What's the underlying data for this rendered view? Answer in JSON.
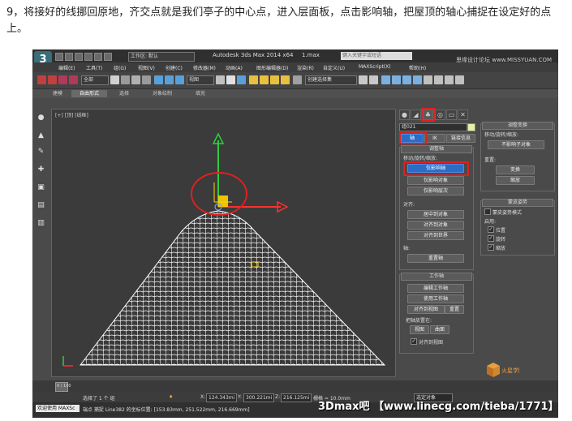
{
  "caption": "9，将接好的线挪回原地，齐交点就是我们亭子的中心点，进入层面板，点击影响轴，把屋顶的轴心捕捉在设定好的点上。",
  "app": {
    "logo": "3",
    "workspace": "工作区: 默认",
    "title": "Autodesk 3ds Max  2014 x64",
    "file": "1.max",
    "search_placeholder": "键入关键字或短语"
  },
  "menu": [
    "编辑(E)",
    "工具(T)",
    "组(G)",
    "视图(V)",
    "创建(C)",
    "修改器(M)",
    "动画(A)",
    "图形编辑器(D)",
    "渲染(R)",
    "自定义(U)",
    "MAXScript(X)",
    "帮助(H)"
  ],
  "toolbar": {
    "mode_dropdown": "全部",
    "view_dropdown": "视图",
    "selection_set": "创建选择集"
  },
  "ribbon": {
    "tabs": [
      "建模",
      "自由形式",
      "选择",
      "对象绘制",
      "填充"
    ],
    "active": "自由形式"
  },
  "viewport": {
    "label": "[+] [顶] [线框]"
  },
  "command_panel": {
    "object_name": "组021",
    "tabs": [
      "轴",
      "IK",
      "链接信息"
    ],
    "adjust_pivot": {
      "title": "调整轴",
      "move_label": "移动/旋转/缩放:",
      "buttons": [
        "仅影响轴",
        "仅影响对象",
        "仅影响层次"
      ],
      "active_button": "仅影响轴",
      "align_label": "对齐:",
      "align_buttons": [
        "居中到对象",
        "对齐到对象",
        "对齐到世界"
      ],
      "pivot_label": "轴:",
      "reset_button": "重置轴"
    },
    "working_pivot": {
      "title": "工作轴",
      "buttons": [
        "编辑工作轴",
        "使用工作轴",
        "对齐到视图",
        "重置"
      ],
      "placement_label": "把轴放置在:",
      "placement_buttons": [
        "视图",
        "曲面"
      ],
      "align_to_view": "对齐到视图"
    }
  },
  "right_panel": {
    "adjust_transform": {
      "title": "调整变换",
      "move_label": "移动/旋转/缩放:",
      "dont_affect_children": "不影响子对象",
      "reset_label": "重置:",
      "reset_buttons": [
        "变换",
        "缩放"
      ]
    },
    "skin_pose": {
      "title": "蒙皮姿势",
      "enable_label": "启用:",
      "checkbox_mode": "蒙皮姿势模式",
      "checkboxes": [
        "位置",
        "旋转",
        "缩放"
      ]
    }
  },
  "status": {
    "frame_text": "0 / 100",
    "selected_text": "选择了 1 个 组",
    "x_label": "X:",
    "x_value": "124.343mi",
    "y_label": "Y:",
    "y_value": "300.221mi",
    "z_label": "Z:",
    "z_value": "216.125mi",
    "grid_label": "栅格 = 10.0mm",
    "welcome": "欢迎使用 MAXSc",
    "prompt": "端点 捕捉 Line382 的坐标位置: [153.83mm, 251.522mm, 216.669mm]",
    "select_dd": "选定对象"
  },
  "watermark": {
    "main": "3Dmax吧 【www.linecg.com/tieba/1771】",
    "site": "思缘设计论坛 www.MISSYUAN.COM",
    "brand": "火星学院"
  },
  "colors": {
    "highlight_red": "#e02020",
    "active_blue": "#2b6cc4",
    "gizmo_green": "#2ecc40",
    "gizmo_red": "#ff3030",
    "gizmo_yellow": "#ffd400"
  }
}
